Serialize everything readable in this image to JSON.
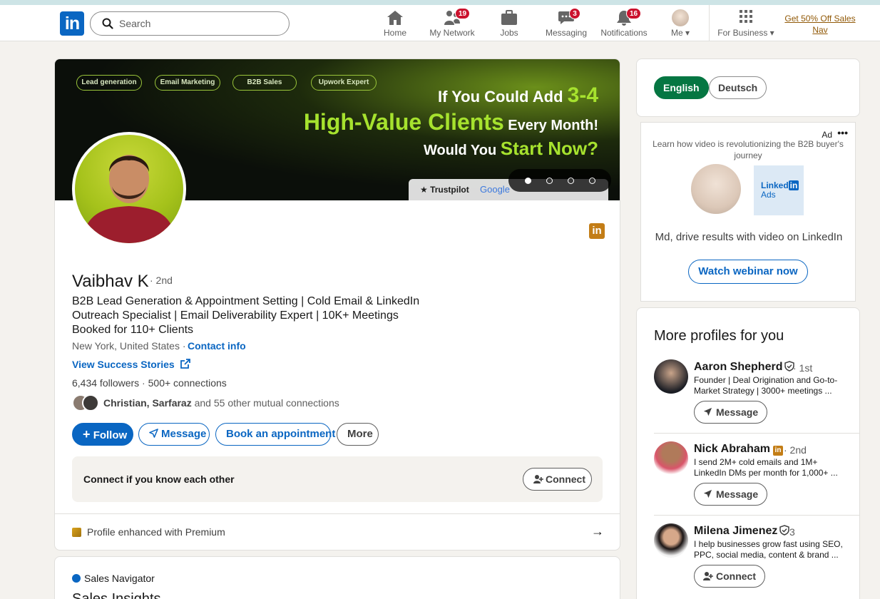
{
  "nav": {
    "logo": "in",
    "search_placeholder": "Search",
    "items": [
      {
        "label": "Home",
        "badge": ""
      },
      {
        "label": "My Network",
        "badge": "19"
      },
      {
        "label": "Jobs",
        "badge": ""
      },
      {
        "label": "Messaging",
        "badge": "3"
      },
      {
        "label": "Notifications",
        "badge": "16"
      },
      {
        "label": "Me",
        "badge": ""
      },
      {
        "label": "For Business",
        "badge": ""
      }
    ],
    "promo": "Get 50% Off Sales Nav"
  },
  "banner": {
    "chips": [
      "Lead generation",
      "Email Marketing",
      "B2B Sales",
      "Upwork Expert"
    ],
    "line1_pre": "If You Could Add ",
    "line1_hl": "3-4",
    "line2_hl": "High-Value Clients",
    "line2_post": " Every Month!",
    "line3_pre": "Would You ",
    "line3_hl": "Start Now?",
    "trust_1": "★ Trustpilot",
    "trust_2": "Google"
  },
  "profile": {
    "name": "Vaibhav K",
    "degree": "· 2nd",
    "headline": "B2B Lead Generation & Appointment Setting | Cold Email & LinkedIn Outreach Specialist | Email Deliverability Expert | 10K+ Meetings Booked for 110+ Clients",
    "location": "New York, United States",
    "contact_info": "Contact info",
    "success_stories": "View Success Stories",
    "followers": "6,434 followers",
    "connections": "500+ connections",
    "mutual_names": "Christian, Sarfaraz",
    "mutual_rest": " and 55 other mutual connections",
    "buttons": {
      "follow": "Follow",
      "message": "Message",
      "book": "Book an appointment",
      "more": "More"
    },
    "connect_prompt": "Connect if you know each other",
    "connect_btn": "Connect",
    "premium": "Profile enhanced with Premium"
  },
  "lang": {
    "english": "English",
    "deutsch": "Deutsch"
  },
  "ad": {
    "label": "Ad",
    "text": "Learn how video is revolutionizing the B2B buyer's journey",
    "logo_1": "Linked",
    "logo_2": "in",
    "logo_3": "Ads",
    "message": "Md, drive results with video on LinkedIn",
    "cta": "Watch webinar now"
  },
  "more_profiles": {
    "title": "More profiles for you",
    "items": [
      {
        "name": "Aaron Shepherd",
        "degree": "· 1st",
        "desc": "Founder | Deal Origination and Go-to-Market Strategy | 3000+ meetings ...",
        "action": "Message"
      },
      {
        "name": "Nick Abraham",
        "degree": "· 2nd",
        "desc": "I send 2M+ cold emails and 1M+ LinkedIn DMs per month for 1,000+ ...",
        "action": "Message"
      },
      {
        "name": "Milena Jimenez",
        "degree": "3",
        "desc": "I help businesses grow fast using SEO, PPC, social media, content & brand ...",
        "action": "Connect"
      }
    ]
  },
  "sales": {
    "nav": "Sales Navigator",
    "insights": "Sales Insights"
  },
  "colors": {
    "brand": "#0a66c2",
    "badge": "#cb112d",
    "green": "#057642",
    "premium": "#c37d16"
  }
}
